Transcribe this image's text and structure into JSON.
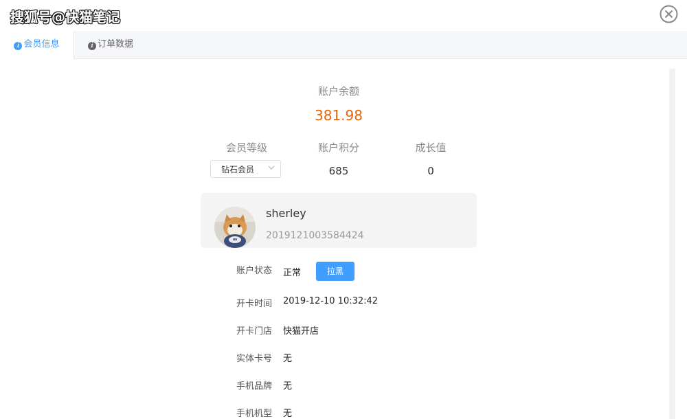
{
  "window": {
    "title": "搜狐号@快猫笔记"
  },
  "tabs": [
    {
      "label": "会员信息",
      "active": true
    },
    {
      "label": "订单数据",
      "active": false
    }
  ],
  "balance": {
    "label": "账户余额",
    "value": "381.98"
  },
  "stats": {
    "level_label": "会员等级",
    "level_value": "钻石会员",
    "points_label": "账户积分",
    "points_value": "685",
    "growth_label": "成长值",
    "growth_value": "0"
  },
  "user": {
    "name": "sherley",
    "id": "2019121003584424"
  },
  "details": [
    {
      "label": "账户状态",
      "value": "正常"
    },
    {
      "label": "开卡时间",
      "value": "2019-12-10 10:32:42"
    },
    {
      "label": "开卡门店",
      "value": "快猫开店"
    },
    {
      "label": "实体卡号",
      "value": "无"
    },
    {
      "label": "手机品牌",
      "value": "无"
    },
    {
      "label": "手机机型",
      "value": "无"
    }
  ],
  "actions": {
    "block_label": "拉黑"
  },
  "colors": {
    "accent": "#409eff",
    "balance": "#e8650a"
  },
  "icons": {
    "close": "close-circle-icon",
    "tab": "info-icon",
    "select": "chevron-down-icon"
  }
}
